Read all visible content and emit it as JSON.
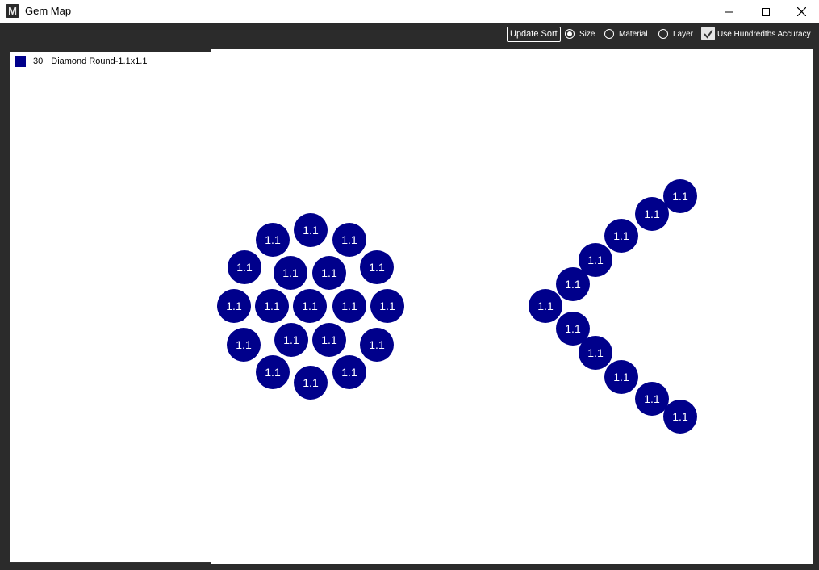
{
  "window": {
    "title": "Gem Map",
    "app_icon_letter": "M"
  },
  "toolbar": {
    "update_sort_label": "Update Sort",
    "sort_options": [
      {
        "label": "Size",
        "checked": true
      },
      {
        "label": "Material",
        "checked": false
      },
      {
        "label": "Layer",
        "checked": false
      }
    ],
    "hundredths_label": "Use Hundredths Accuracy",
    "hundredths_checked": true
  },
  "legend": [
    {
      "count": "30",
      "name": "Diamond Round-1.1x1.1",
      "color": "#00008b"
    }
  ],
  "gem_label": "1.1",
  "gem_color": "#00008b"
}
